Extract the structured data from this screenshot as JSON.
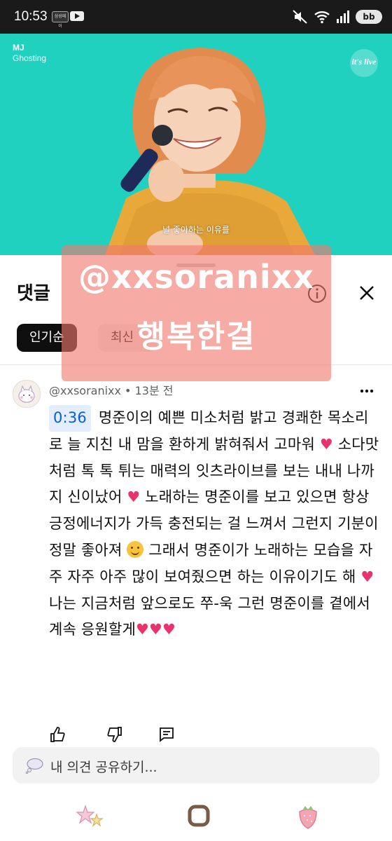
{
  "status_bar": {
    "time": "10:53",
    "badge_text": "삼성페이 LOUNGE",
    "battery": "bb"
  },
  "video": {
    "artist": "MJ",
    "song": "Ghosting",
    "logo": "it's live",
    "subtitle": "널 좋아하는 이유를"
  },
  "comments_sheet": {
    "title": "댓글",
    "sort_tabs": [
      {
        "label": "인기순",
        "active": true
      },
      {
        "label": "최신",
        "active": false
      }
    ]
  },
  "comment": {
    "author": "@xxsoranixx",
    "separator": " • ",
    "age": "13분 전",
    "timestamp": "0:36",
    "text_1": " 명준이의 예쁜 미소처럼 밝고 경쾌한 목소리로 늘 지친 내 맘을 환하게 밝혀줘서 고마워 ",
    "heart": "♥",
    "text_2": " 소다맛처럼 톡 톡 튀는 매력의 잇츠라이브를 보는 내내 나까지 신이났어 ",
    "text_3": " 노래하는 명준이를 보고 있으면 항상 긍정에너지가 가득 충전되는 걸 느껴서 그런지 기분이 정말 좋아져 ",
    "text_4": " 그래서 명준이가 노래하는 모습을  자주 자주 아주 많이 보여줬으면 하는 이유이기도 해 ",
    "text_5": " 나는 지금처럼 앞으로도 쭈-욱 그런 명준이를 곁에서 계속 응원할게",
    "hearts_end": "♥♥♥"
  },
  "compose": {
    "placeholder": "내 의견 공유하기..."
  },
  "watermark": {
    "handle": "@xxsoranixx",
    "caption": "행복한걸"
  },
  "colors": {
    "video_bg": "#20d1c0",
    "watermark": "#f0786e",
    "heart": "#e8336d",
    "timestamp_link": "#065fd4"
  },
  "icons": {
    "status": [
      "mute-icon",
      "wifi-icon",
      "signal-icon",
      "battery-icon"
    ],
    "sheet": [
      "info-icon",
      "close-icon"
    ],
    "actions": [
      "thumbs-up-icon",
      "thumbs-down-icon",
      "reply-icon",
      "more-icon"
    ],
    "nav": [
      "stars-icon",
      "home-square-icon",
      "strawberry-icon"
    ]
  }
}
